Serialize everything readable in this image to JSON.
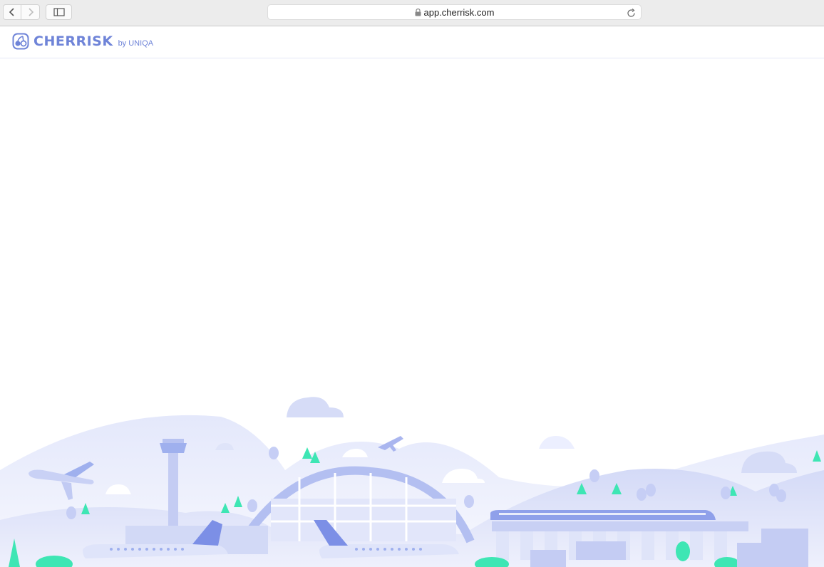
{
  "browser": {
    "url": "app.cherrisk.com",
    "icons": {
      "back": "chevron-left-icon",
      "forward": "chevron-right-icon",
      "sidebar": "sidebar-icon",
      "lock": "lock-icon",
      "reload": "reload-icon"
    }
  },
  "header": {
    "brand_name": "CHERRISK",
    "brand_suffix": "by UNIQA"
  },
  "colors": {
    "brand": "#6f84d8",
    "accent_green": "#3ee6b4",
    "illustration_light": "#e6eafb",
    "illustration_mid": "#b7c2f1"
  }
}
